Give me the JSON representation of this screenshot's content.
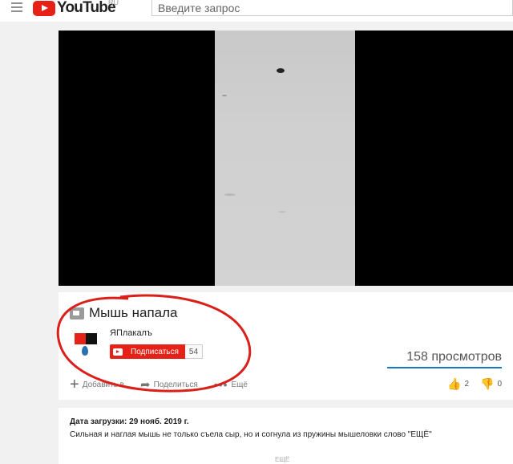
{
  "header": {
    "logo_text": "YouTube",
    "logo_region": "RU",
    "search_placeholder": "Введите запрос"
  },
  "video": {
    "title": "Мышь напала",
    "channel": "ЯПлакалъ",
    "subscribe_label": "Подписаться",
    "subscriber_count": "54",
    "views": "158 просмотров",
    "actions": {
      "add": "Добавить в",
      "share": "Поделиться",
      "more": "Ещё"
    },
    "likes": "2",
    "dislikes": "0"
  },
  "description": {
    "upload_date": "Дата загрузки: 29 нояб. 2019 г.",
    "text": "Сильная и наглая мышь не только съела сыр, но и согнула из пружины мышеловки слово \"ЕЩЁ\"",
    "show_more": "ЕЩЁ"
  },
  "colors": {
    "brand_red": "#e62117",
    "annotation_red": "#d9201a",
    "views_bar": "#167ac6"
  }
}
